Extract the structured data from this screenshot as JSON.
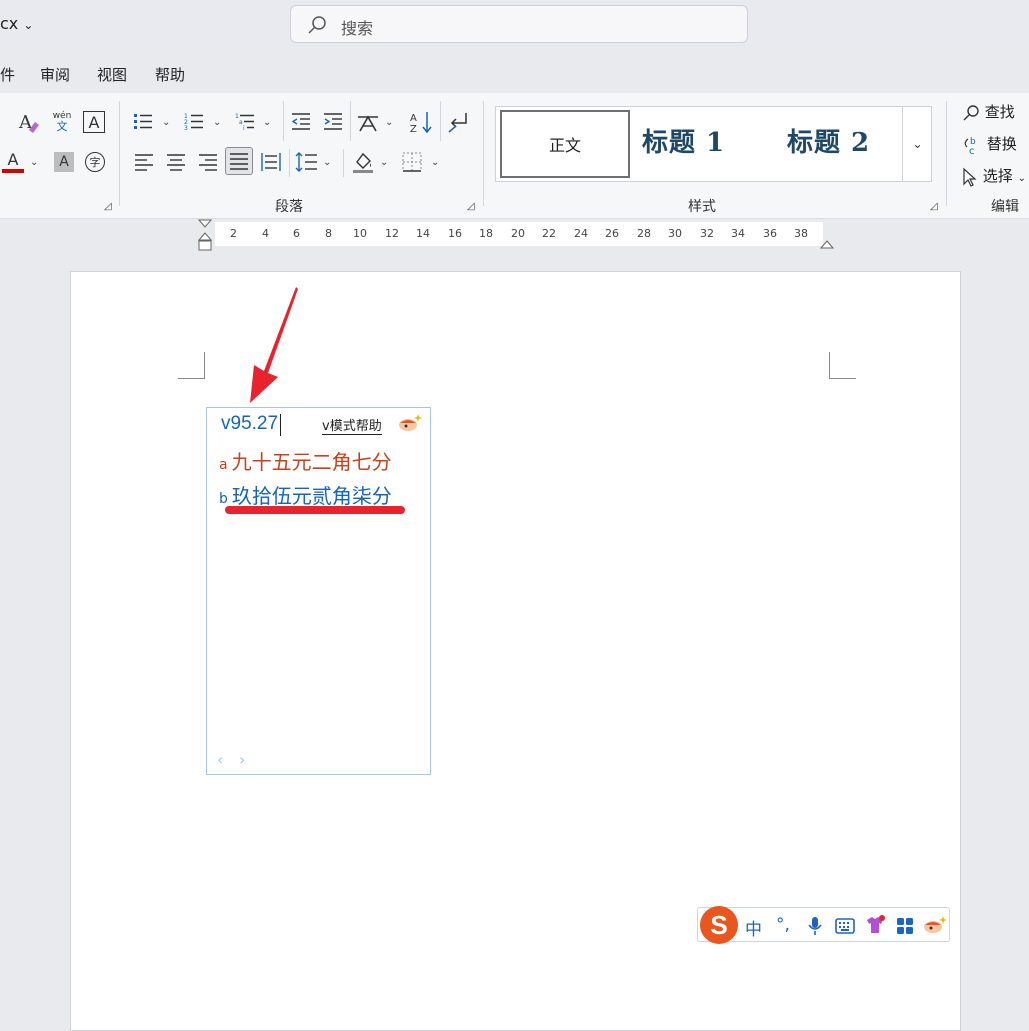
{
  "title_bar": {
    "filename": "cx",
    "search_placeholder": "搜索"
  },
  "menu": {
    "items": [
      "件",
      "审阅",
      "视图",
      "帮助"
    ]
  },
  "ribbon": {
    "groups": {
      "paragraph": "段落",
      "styles": "样式",
      "editing": "编辑"
    },
    "font_buttons": {
      "wen_top": "wén",
      "wen_bottom": "文",
      "char_border": "A",
      "font_color": "A",
      "char_shading": "A",
      "enclose": "字"
    },
    "styles": [
      "正文",
      "标题 1",
      "标题 2"
    ],
    "editing": {
      "find": "查找",
      "replace": "替换",
      "select": "选择"
    }
  },
  "ruler": {
    "ticks": [
      "2",
      "4",
      "6",
      "8",
      "10",
      "12",
      "14",
      "16",
      "18",
      "20",
      "22",
      "24",
      "26",
      "28",
      "30",
      "32",
      "34",
      "36",
      "38"
    ]
  },
  "ime": {
    "input": "v95.27",
    "help": "v模式帮助",
    "candidates": [
      {
        "index": "a",
        "text": "九十五元二角七分",
        "color": "#c8401e"
      },
      {
        "index": "b",
        "text": "玖拾伍元贰角柒分",
        "color": "#1764b5"
      }
    ],
    "pager_prev": "‹",
    "pager_next": "›"
  },
  "ime_toolbar": {
    "logo": "S",
    "lang": "中",
    "punct": "°,",
    "mic": "mic-icon",
    "keyboard": "keyboard-icon",
    "skin": "skin-icon",
    "apps": "apps-icon"
  },
  "colors": {
    "accent": "#1764b5",
    "annotation": "#e8232d",
    "font_color_bar": "#d40000"
  }
}
